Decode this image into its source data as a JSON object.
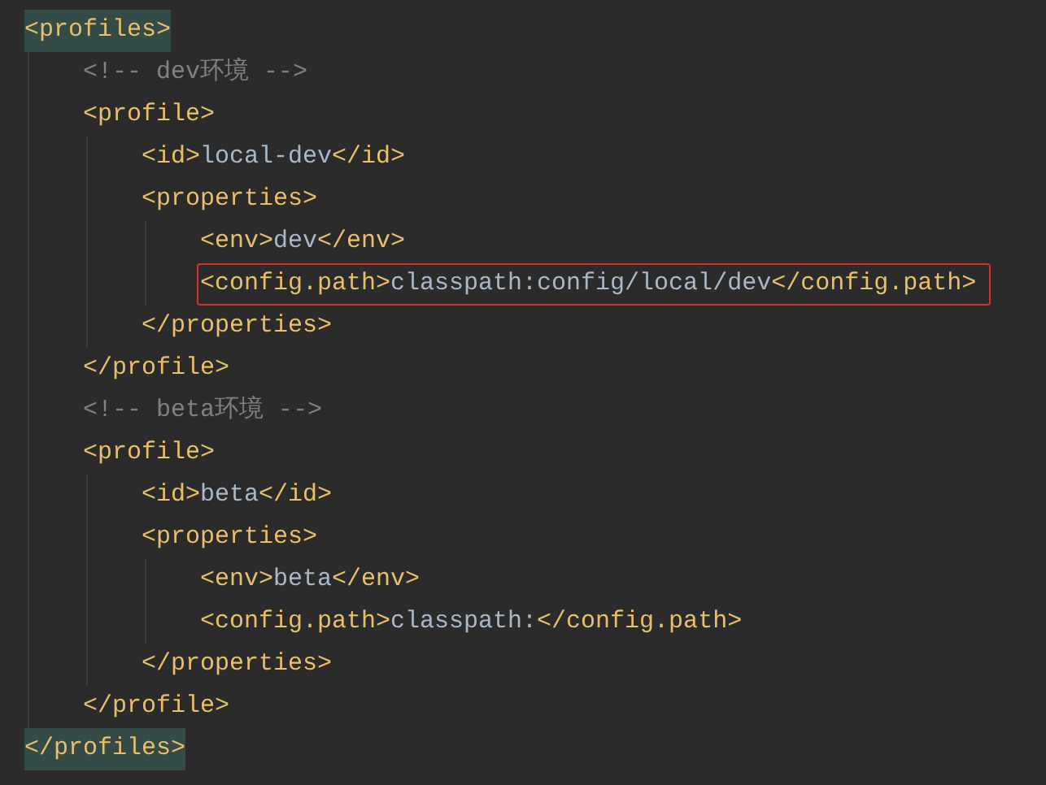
{
  "editor": {
    "lines": [
      {
        "kind": "element",
        "open": "<profiles>",
        "close": "</profiles>",
        "highlighted": true,
        "children": [
          {
            "kind": "comment",
            "text": "<!-- dev环境 -->"
          },
          {
            "kind": "element",
            "open": "<profile>",
            "close": "</profile>",
            "highlighted": false,
            "children": [
              {
                "kind": "leaf",
                "open": "<id>",
                "value": "local-dev",
                "close": "</id>",
                "boxed": false
              },
              {
                "kind": "element",
                "open": "<properties>",
                "close": "</properties>",
                "highlighted": false,
                "children": [
                  {
                    "kind": "leaf",
                    "open": "<env>",
                    "value": "dev",
                    "close": "</env>",
                    "boxed": false
                  },
                  {
                    "kind": "leaf",
                    "open": "<config.path>",
                    "value": "classpath:config/local/dev",
                    "close": "</config.path>",
                    "boxed": true
                  }
                ]
              }
            ]
          },
          {
            "kind": "comment",
            "text": "<!-- beta环境 -->"
          },
          {
            "kind": "element",
            "open": "<profile>",
            "close": "</profile>",
            "highlighted": false,
            "children": [
              {
                "kind": "leaf",
                "open": "<id>",
                "value": "beta",
                "close": "</id>",
                "boxed": false
              },
              {
                "kind": "element",
                "open": "<properties>",
                "close": "</properties>",
                "highlighted": false,
                "children": [
                  {
                    "kind": "leaf",
                    "open": "<env>",
                    "value": "beta",
                    "close": "</env>",
                    "boxed": false
                  },
                  {
                    "kind": "leaf",
                    "open": "<config.path>",
                    "value": "classpath:",
                    "close": "</config.path>",
                    "boxed": false
                  }
                ]
              }
            ]
          }
        ]
      }
    ]
  }
}
